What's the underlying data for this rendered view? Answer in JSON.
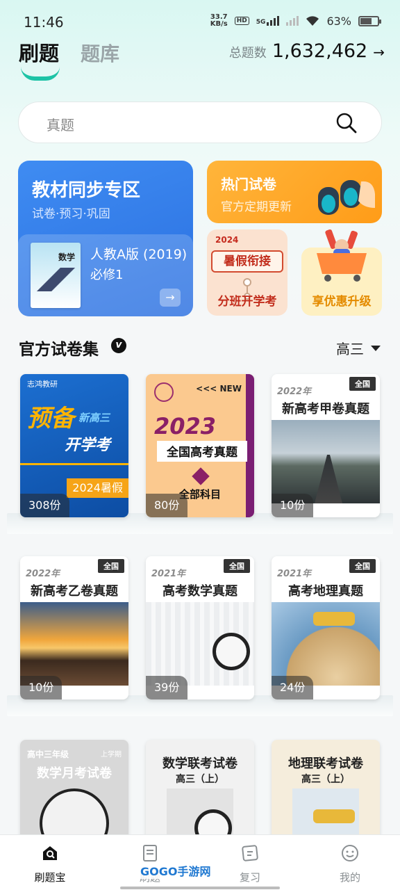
{
  "status_bar": {
    "time": "11:46",
    "net_speed_value": "33.7",
    "net_speed_unit": "KB/s",
    "hd": "HD",
    "network": "5G",
    "battery": "63%"
  },
  "header": {
    "tab_active": "刷题",
    "tab_other": "题库",
    "total_label": "总题数",
    "total_value": "1,632,462",
    "total_arrow": "→"
  },
  "search": {
    "placeholder": "真题"
  },
  "cards": {
    "textbook": {
      "title": "教材同步专区",
      "subtitle": "试卷·预习·巩固",
      "book_cover_text": "数学",
      "book_line1": "人教A版 (2019)",
      "book_line2": "必修1",
      "go": "→"
    },
    "hot": {
      "title": "热门试卷",
      "subtitle": "官方定期更新"
    },
    "summer": {
      "year": "2024",
      "title": "暑假衔接",
      "subtitle": "分班开学考"
    },
    "vip": {
      "label": "享优惠升级"
    }
  },
  "section": {
    "title": "官方试卷集",
    "badge": "v",
    "grade": "高三"
  },
  "papers": [
    {
      "brand": "志鸿教研",
      "big": "预备",
      "mid": "新高三",
      "exam": "开学考",
      "tag": "2024暑假",
      "count": "308份"
    },
    {
      "new": "<<< NEW",
      "year": "2023",
      "title": "全国高考真题",
      "sub": "全部科目",
      "count": "80份"
    },
    {
      "year": "2022年",
      "badge": "全国",
      "title": "新高考甲卷真题",
      "count": "10份"
    },
    {
      "year": "2022年",
      "badge": "全国",
      "title": "新高考乙卷真题",
      "count": "10份"
    },
    {
      "year": "2021年",
      "badge": "全国",
      "title": "高考数学真题",
      "count": "39份"
    },
    {
      "year": "2021年",
      "badge": "全国",
      "title": "高考地理真题",
      "count": "24份"
    },
    {
      "grade": "高中三年级",
      "term": "上学期",
      "title": "数学月考试卷"
    },
    {
      "title": "数学联考试卷",
      "sub": "高三（上）"
    },
    {
      "title": "地理联考试卷",
      "sub": "高三（上）"
    }
  ],
  "tabbar": {
    "items": [
      {
        "label": "刷题宝",
        "icon": "search-home-icon"
      },
      {
        "label": "刷题",
        "icon": "paper-scroll-icon"
      },
      {
        "label": "复习",
        "icon": "review-card-icon"
      },
      {
        "label": "我的",
        "icon": "smiley-icon"
      }
    ],
    "watermark": "GOGO手游网"
  },
  "colors": {
    "accent": "#1dc3a6",
    "blue_card": "#3f8cf2",
    "orange_card": "#ffa52a"
  }
}
